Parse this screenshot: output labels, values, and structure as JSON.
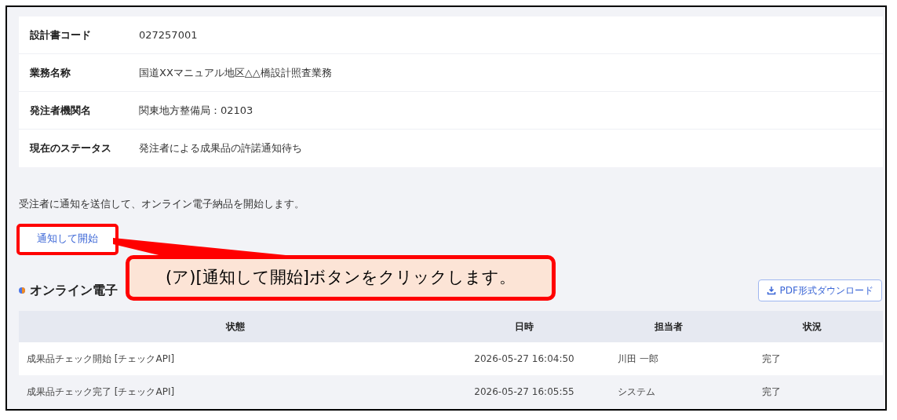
{
  "details": [
    {
      "label": "設計書コード",
      "value": "027257001"
    },
    {
      "label": "業務名称",
      "value": "国道XXマニュアル地区△△橋設計照査業務"
    },
    {
      "label": "発注者機関名",
      "value": "関東地方整備局：02103"
    },
    {
      "label": "現在のステータス",
      "value": "発注者による成果品の許諾通知待ち"
    }
  ],
  "notice": "受注者に通知を送信して、オンライン電子納品を開始します。",
  "start_button": "通知して開始",
  "callout": "(ア)[通知して開始]ボタンをクリックします。",
  "history": {
    "title": "オンライン電子",
    "download_button": "PDF形式ダウンロード",
    "columns": [
      "状態",
      "日時",
      "担当者",
      "状況"
    ],
    "rows": [
      [
        "成果品チェック開始 [チェックAPI]",
        "2026-05-27 16:04:50",
        "川田 一郎",
        "完了"
      ],
      [
        "成果品チェック完了 [チェックAPI]",
        "2026-05-27 16:05:55",
        "システム",
        "完了"
      ]
    ]
  }
}
